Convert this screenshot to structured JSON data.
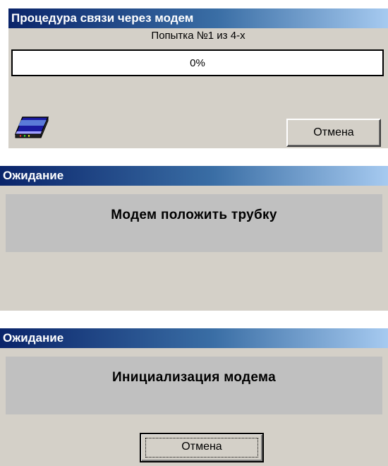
{
  "dialog1": {
    "title": "Процедура связи через модем",
    "attempt_text": "Попытка №1 из 4-х",
    "progress_value": 0,
    "progress_text": "0%",
    "icon": "modem-icon",
    "cancel_label": "Отмена"
  },
  "dialog2": {
    "title": "Ожидание",
    "message": "Модем положить трубку"
  },
  "dialog3": {
    "title": "Ожидание",
    "message": "Инициализация модема",
    "cancel_label": "Отмена"
  },
  "colors": {
    "titlebar_start": "#0a246a",
    "titlebar_end": "#a6caf0",
    "dialog_bg": "#d4d0c8",
    "message_panel_bg": "#c0c0c0"
  }
}
